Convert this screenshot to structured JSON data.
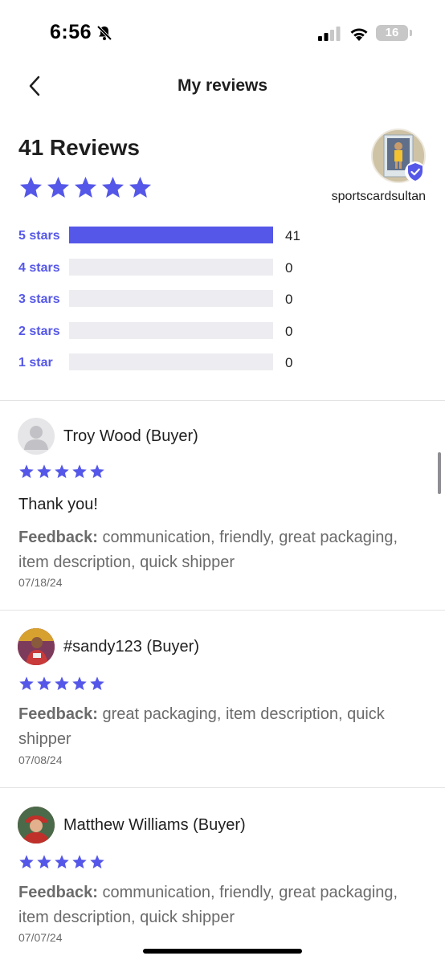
{
  "status_bar": {
    "time": "6:56",
    "battery": "16",
    "icons": [
      "bell-slash-icon",
      "cellular-signal-icon",
      "wifi-icon",
      "battery-icon"
    ]
  },
  "nav": {
    "title": "My reviews",
    "back_icon": "chevron-left-icon"
  },
  "summary": {
    "count_label": "41 Reviews",
    "rating": 5,
    "seller_name": "sportscardsultan",
    "verified": true
  },
  "distribution": [
    {
      "label": "5 stars",
      "count": "41",
      "fraction": 1.0
    },
    {
      "label": "4 stars",
      "count": "0",
      "fraction": 0
    },
    {
      "label": "3 stars",
      "count": "0",
      "fraction": 0
    },
    {
      "label": "2 stars",
      "count": "0",
      "fraction": 0
    },
    {
      "label": "1 star",
      "count": "0",
      "fraction": 0
    }
  ],
  "reviews": [
    {
      "name": "Troy Wood (Buyer)",
      "rating": 5,
      "comment": "Thank you!",
      "feedback_label": "Feedback:",
      "feedback": "communication, friendly, great packaging, item description, quick shipper",
      "date": "07/18/24"
    },
    {
      "name": "#sandy123 (Buyer)",
      "rating": 5,
      "feedback_label": "Feedback:",
      "feedback": "great packaging, item description, quick shipper",
      "date": "07/08/24"
    },
    {
      "name": "Matthew Williams (Buyer)",
      "rating": 5,
      "feedback_label": "Feedback:",
      "feedback": "communication, friendly, great packaging, item description, quick shipper",
      "date": "07/07/24"
    }
  ],
  "colors": {
    "accent": "#5557e8",
    "text": "#1f1f1f",
    "muted": "#6b6b6b",
    "bar_track": "#ececf1"
  }
}
